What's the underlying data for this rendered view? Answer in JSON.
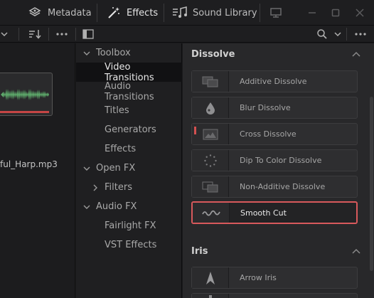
{
  "toolbar": {
    "metadata_label": "Metadata",
    "effects_label": "Effects",
    "sound_library_label": "Sound Library"
  },
  "media": {
    "clip_name": "ful_Harp.mp3"
  },
  "tree": {
    "items": [
      {
        "label": "Toolbox",
        "expandable": true,
        "expanded": true
      },
      {
        "label": "Video Transitions",
        "selected": true
      },
      {
        "label": "Audio Transitions"
      },
      {
        "label": "Titles"
      },
      {
        "label": "Generators"
      },
      {
        "label": "Effects"
      },
      {
        "label": "Open FX",
        "expandable": true,
        "expanded": true
      },
      {
        "label": "Filters",
        "expandable": true,
        "expanded": false
      },
      {
        "label": "Audio FX",
        "expandable": true,
        "expanded": true
      },
      {
        "label": "Fairlight FX"
      },
      {
        "label": "VST Effects"
      }
    ]
  },
  "effects_panel": {
    "sections": [
      {
        "title": "Dissolve",
        "items": [
          {
            "label": "Additive Dissolve",
            "icon": "additive-dissolve-icon"
          },
          {
            "label": "Blur Dissolve",
            "icon": "blur-drop-icon"
          },
          {
            "label": "Cross Dissolve",
            "icon": "cross-dissolve-icon"
          },
          {
            "label": "Dip To Color Dissolve",
            "icon": "dotted-circle-icon"
          },
          {
            "label": "Non-Additive Dissolve",
            "icon": "non-additive-dissolve-icon"
          },
          {
            "label": "Smooth Cut",
            "icon": "wave-icon",
            "active": true
          }
        ]
      },
      {
        "title": "Iris",
        "items": [
          {
            "label": "Arrow Iris",
            "icon": "arrow-iris-icon"
          }
        ]
      }
    ]
  },
  "colors": {
    "accent_active_border": "#d8595c",
    "waveform_green": "#5da86a",
    "clip_bar_red": "#c54545"
  }
}
